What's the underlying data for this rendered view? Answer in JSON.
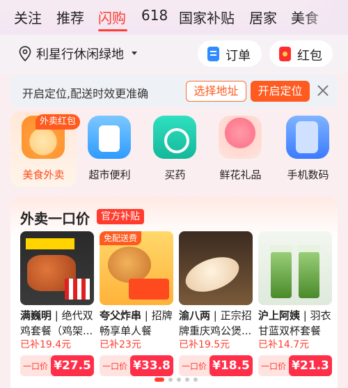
{
  "top_tabs": [
    "关注",
    "推荐",
    "闪购",
    "618",
    "国家补贴",
    "居家",
    "美食"
  ],
  "active_tab": "闪购",
  "location": {
    "name": "利星行休闲绿地"
  },
  "actions": {
    "order_label": "订单",
    "redpacket_label": "红包"
  },
  "notice": {
    "text": "开启定位,配送时效更准确",
    "select_address": "选择地址",
    "enable_location": "开启定位"
  },
  "categories": [
    {
      "label": "美食外卖",
      "icon": "takeout-bowl-icon",
      "badge": "外卖红包",
      "active": true
    },
    {
      "label": "超市便利",
      "icon": "grocery-bag-icon"
    },
    {
      "label": "买药",
      "icon": "medicine-kit-icon"
    },
    {
      "label": "鲜花礼品",
      "icon": "flower-bouquet-icon"
    },
    {
      "label": "手机数码",
      "icon": "phone-earbuds-icon"
    }
  ],
  "promo": {
    "title": "外卖一口价",
    "tag": "官方补贴",
    "products": [
      {
        "brand": "满巍明",
        "desc": "绝代双鸡套餐（鸡架...",
        "subsidy": "已补19.4元",
        "price_label": "一口价",
        "price": "¥27.5"
      },
      {
        "brand": "夸父炸串",
        "desc": "招牌畅享单人餐",
        "subsidy": "已补23元",
        "price_label": "一口价",
        "price": "¥33.8",
        "badge": "免配送费"
      },
      {
        "brand": "渝八两",
        "desc": "正宗招牌重庆鸡公煲...",
        "subsidy": "已补19.5元",
        "price_label": "一口价",
        "price": "¥18.5"
      },
      {
        "brand": "沪上阿姨",
        "desc": "羽衣甘蓝双杯套餐",
        "subsidy": "已补14.7元",
        "price_label": "一口价",
        "price": "¥21.3"
      }
    ]
  },
  "colors": {
    "accent": "#ff3c2e",
    "orange": "#ff5a1f",
    "price_red": "#ff2f4a"
  }
}
